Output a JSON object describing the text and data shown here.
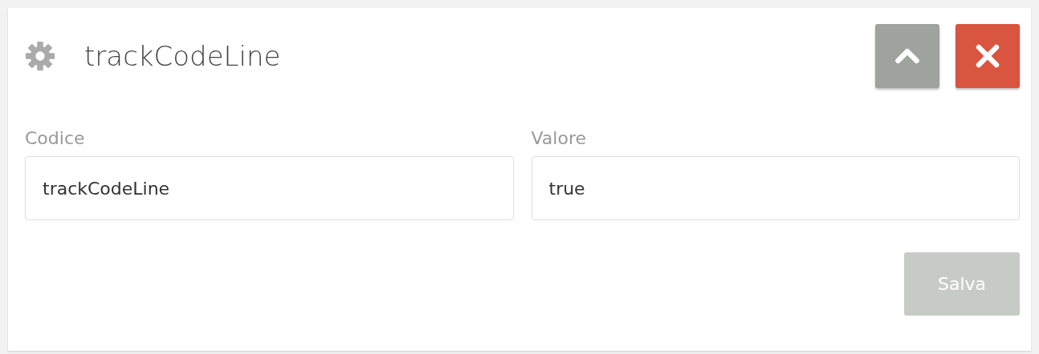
{
  "panel": {
    "title": "trackCodeLine"
  },
  "fields": [
    {
      "label": "Codice",
      "value": "trackCodeLine"
    },
    {
      "label": "Valore",
      "value": "true"
    }
  ],
  "save_button": {
    "label": "Salva",
    "disabled": true
  }
}
